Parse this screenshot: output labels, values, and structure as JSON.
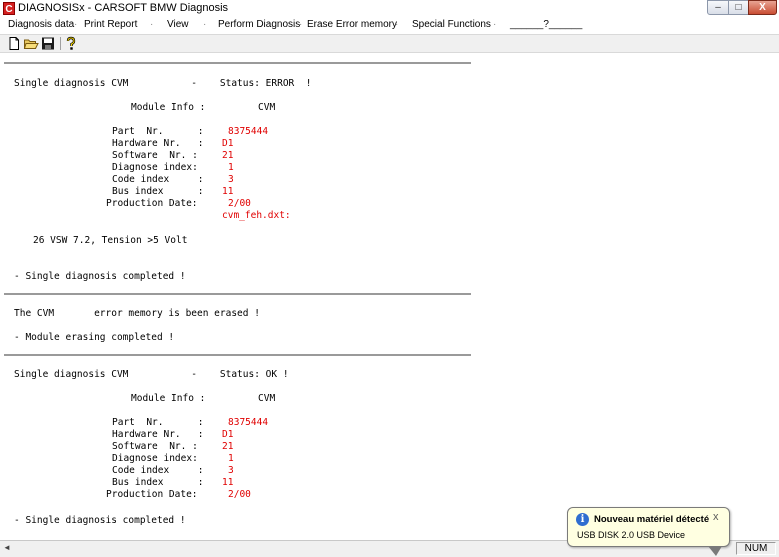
{
  "window": {
    "title": "DIAGNOSISx - CARSOFT BMW Diagnosis",
    "app_icon_letter": "C",
    "controls": {
      "minimize": "–",
      "maximize": "□",
      "close": "X"
    }
  },
  "menu": {
    "items": [
      "Diagnosis data",
      "Print Report",
      "View",
      "Perform Diagnosis",
      "Erase Error memory",
      "Special Functions",
      "______?______"
    ],
    "separator": "·"
  },
  "toolbar": {
    "buttons": [
      "new-icon",
      "open-icon",
      "save-icon",
      "help-icon"
    ]
  },
  "report": {
    "diag1": {
      "header": "Single diagnosis CVM           -    Status: ERROR  !",
      "module_info_label": "Module Info :",
      "module_info_value": "CVM",
      "fields": [
        {
          "label": "Part  Nr.      :",
          "value": "8375444"
        },
        {
          "label": "Hardware Nr.   :",
          "value": "D1"
        },
        {
          "label": "Software  Nr. :",
          "value": "21"
        },
        {
          "label": "Diagnose index:",
          "value": "1"
        },
        {
          "label": "Code index     :",
          "value": "3"
        },
        {
          "label": "Bus index      :",
          "value": "11"
        },
        {
          "label": "Production Date:",
          "value": "2/00"
        }
      ],
      "file": "cvm_feh.dxt:",
      "error_line": "26 VSW 7.2, Tension >5 Volt",
      "completed": "- Single diagnosis completed !"
    },
    "erase": {
      "line1": "The CVM       error memory is been erased !",
      "line2": "- Module erasing completed !"
    },
    "diag2": {
      "header": "Single diagnosis CVM           -    Status: OK !",
      "module_info_label": "Module Info :",
      "module_info_value": "CVM",
      "fields": [
        {
          "label": "Part  Nr.      :",
          "value": "8375444"
        },
        {
          "label": "Hardware Nr.   :",
          "value": "D1"
        },
        {
          "label": "Software  Nr. :",
          "value": "21"
        },
        {
          "label": "Diagnose index:",
          "value": "1"
        },
        {
          "label": "Code index     :",
          "value": "3"
        },
        {
          "label": "Bus index      :",
          "value": "11"
        },
        {
          "label": "Production Date:",
          "value": "2/00"
        }
      ],
      "completed": "- Single diagnosis completed !"
    }
  },
  "statusbar": {
    "scroll_left": "◄",
    "num": "NUM"
  },
  "notification": {
    "title": "Nouveau matériel détecté",
    "text": "USB DISK 2.0 USB Device",
    "close": "x",
    "icon": "info-icon"
  }
}
